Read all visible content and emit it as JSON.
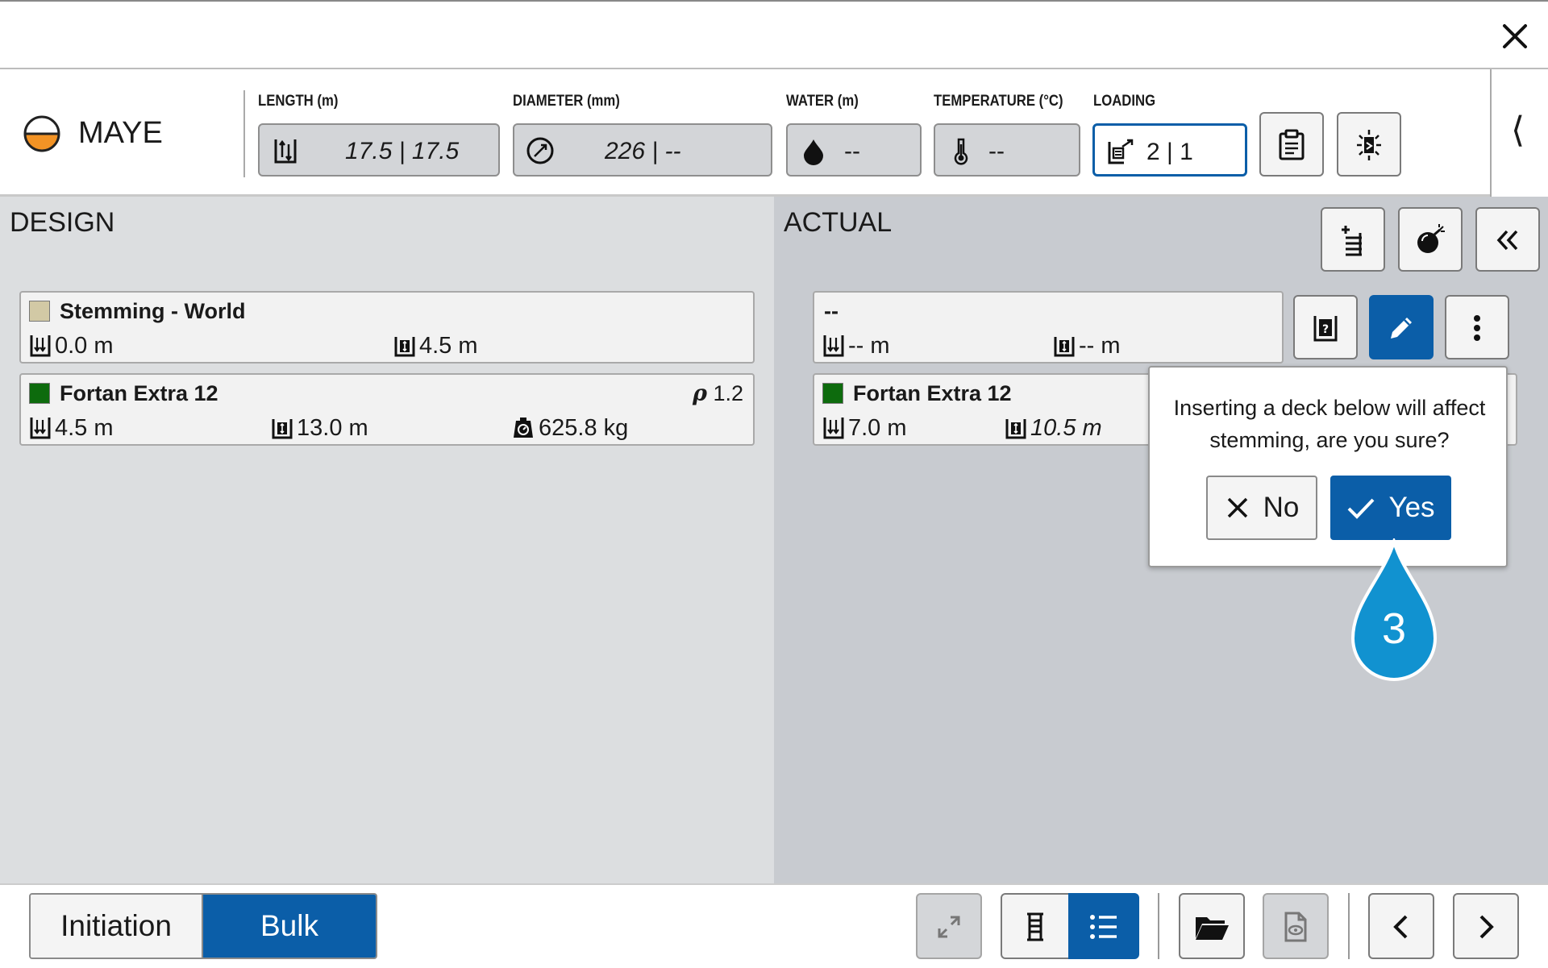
{
  "header": {
    "hole_name": "MAYE",
    "fields": {
      "length": {
        "label": "LENGTH (m)",
        "value": "17.5 | 17.5"
      },
      "diameter": {
        "label": "DIAMETER (mm)",
        "value": "226 | --"
      },
      "water": {
        "label": "WATER (m)",
        "value": "--"
      },
      "temperature": {
        "label": "TEMPERATURE (°C)",
        "value": "--"
      },
      "loading": {
        "label": "LOADING",
        "value": "2 | 1"
      }
    },
    "rail_glyph": "⟨"
  },
  "design": {
    "title": "DESIGN",
    "decks": [
      {
        "name": "Stemming - World",
        "color": "#d2c9a5",
        "top": "0.0 m",
        "length": "4.5 m"
      },
      {
        "name": "Fortan Extra 12",
        "color": "#0d6b0d",
        "top": "4.5 m",
        "length": "13.0 m",
        "mass": "625.8 kg",
        "rho_symbol": "ρ",
        "rho_value": "1.2"
      }
    ]
  },
  "actual": {
    "title": "ACTUAL",
    "decks": [
      {
        "name": "--",
        "top": "-- m",
        "length": "-- m"
      },
      {
        "name": "Fortan Extra 12",
        "color": "#0d6b0d",
        "top": "7.0 m",
        "length": "10.5 m"
      }
    ]
  },
  "popover": {
    "message": "Inserting a deck below will affect stemming, are you sure?",
    "no_label": "No",
    "yes_label": "Yes"
  },
  "step_marker": "3",
  "bottom": {
    "initiation_label": "Initiation",
    "bulk_label": "Bulk"
  },
  "colors": {
    "accent_blue": "#0b5ea8",
    "marker_blue": "#1192d0",
    "hole_orange": "#f39325"
  }
}
